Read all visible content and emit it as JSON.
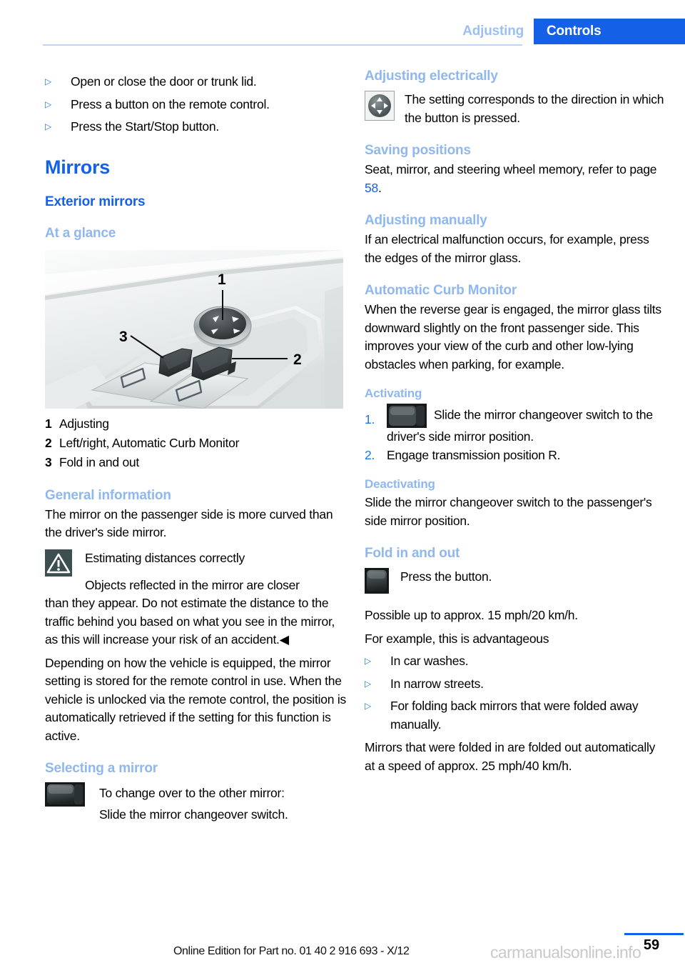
{
  "header": {
    "tab_inactive": "Adjusting",
    "tab_active": "Controls",
    "accent_color": "#1460e6",
    "muted_accent_color": "#8fb8ee"
  },
  "left_column": {
    "intro_bullets": [
      "Open or close the door or trunk lid.",
      "Press a button on the remote control.",
      "Press the Start/Stop button."
    ],
    "title_mirrors": "Mirrors",
    "heading_exterior": "Exterior mirrors",
    "heading_at_a_glance": "At a glance",
    "illustration_labels": [
      "1",
      "2",
      "3"
    ],
    "legend": [
      {
        "num": "1",
        "text": "Adjusting"
      },
      {
        "num": "2",
        "text": "Left/right, Automatic Curb Monitor"
      },
      {
        "num": "3",
        "text": "Fold in and out"
      }
    ],
    "heading_general": "General information",
    "general_text": "The mirror on the passenger side is more curved than the driver's side mirror.",
    "warning_title": "Estimating distances correctly",
    "warning_text_first": "Objects reflected in the mirror are closer",
    "warning_text_rest": "than they appear. Do not estimate the distance to the traffic behind you based on what you see in the mirror, as this will increase your risk of an accident.◀",
    "remote_text": "Depending on how the vehicle is equipped, the mirror setting is stored for the remote control in use. When the vehicle is unlocked via the remote control, the position is automatically retrieved if the setting for this function is active.",
    "heading_selecting": "Selecting a mirror",
    "selecting_line1": "To change over to the other mirror:",
    "selecting_line2": "Slide the mirror changeover switch."
  },
  "right_column": {
    "heading_adjusting_electrically": "Adjusting electrically",
    "adjusting_electrically_text": "The setting corresponds to the direction in which the button is pressed.",
    "heading_saving_positions": "Saving positions",
    "saving_positions_text_before": "Seat, mirror, and steering wheel memory, refer to page ",
    "saving_positions_page": "58",
    "saving_positions_text_after": ".",
    "heading_adjusting_manually": "Adjusting manually",
    "adjusting_manually_text": "If an electrical malfunction occurs, for example, press the edges of the mirror glass.",
    "heading_curb_monitor": "Automatic Curb Monitor",
    "curb_monitor_text": "When the reverse gear is engaged, the mirror glass tilts downward slightly on the front passenger side. This improves your view of the curb and other low-lying obstacles when parking, for example.",
    "heading_activating": "Activating",
    "activating_step1_num": "1.",
    "activating_step1_text": "Slide the mirror changeover switch to the driver's side mirror position.",
    "activating_step2_num": "2.",
    "activating_step2_text": "Engage transmission position R.",
    "heading_deactivating": "Deactivating",
    "deactivating_text": "Slide the mirror changeover switch to the passenger's side mirror position.",
    "heading_fold": "Fold in and out",
    "fold_press_text": "Press the button.",
    "fold_speed_text": "Possible up to approx. 15 mph/20 km/h.",
    "fold_example_lead": "For example, this is advantageous",
    "fold_bullets": [
      "In car washes.",
      "In narrow streets.",
      "For folding back mirrors that were folded away manually."
    ],
    "fold_auto_text": "Mirrors that were folded in are folded out automatically at a speed of approx. 25 mph/40 km/h."
  },
  "footer": {
    "edition": "Online Edition for Part no. 01 40 2 916 693 - X/12",
    "watermark": "carmanualsonline.info",
    "page_number": "59"
  }
}
